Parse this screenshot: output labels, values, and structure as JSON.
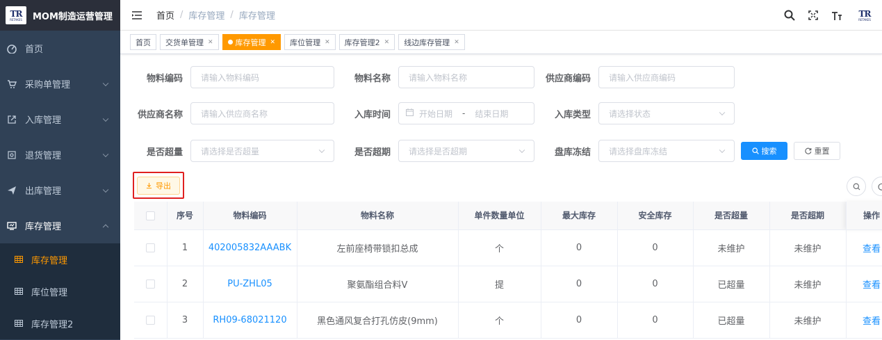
{
  "app": {
    "title": "MOM制造运营管理",
    "logo_text": "TR",
    "logo_sub": "RETAKES"
  },
  "sidebar": {
    "items": [
      {
        "label": "首页",
        "icon": "dashboard-icon"
      },
      {
        "label": "采购单管理",
        "icon": "cart-icon"
      },
      {
        "label": "入库管理",
        "icon": "external-link-icon"
      },
      {
        "label": "退货管理",
        "icon": "return-icon"
      },
      {
        "label": "出库管理",
        "icon": "send-icon"
      },
      {
        "label": "库存管理",
        "icon": "monitor-icon"
      }
    ],
    "sub_items": [
      {
        "label": "库存管理",
        "active": true
      },
      {
        "label": "库位管理"
      },
      {
        "label": "库存管理2"
      }
    ]
  },
  "breadcrumb": {
    "home": "首页",
    "level1": "库存管理",
    "level2": "库存管理",
    "sep": "/"
  },
  "tags": [
    {
      "label": "首页"
    },
    {
      "label": "交货单管理"
    },
    {
      "label": "库存管理",
      "active": true
    },
    {
      "label": "库位管理"
    },
    {
      "label": "库存管理2"
    },
    {
      "label": "线边库存管理"
    }
  ],
  "form": {
    "material_code": {
      "label": "物料编码",
      "placeholder": "请输入物料编码"
    },
    "material_name": {
      "label": "物料名称",
      "placeholder": "请输入物料名称"
    },
    "supplier_code": {
      "label": "供应商编码",
      "placeholder": "请输入供应商编码"
    },
    "supplier_name": {
      "label": "供应商名称",
      "placeholder": "请输入供应商名称"
    },
    "inbound_time": {
      "label": "入库时间",
      "start_placeholder": "开始日期",
      "range_sep": "-",
      "end_placeholder": "结束日期"
    },
    "inbound_type": {
      "label": "入库类型",
      "placeholder": "请选择状态"
    },
    "over_qty": {
      "label": "是否超量",
      "placeholder": "请选择是否超量"
    },
    "over_due": {
      "label": "是否超期",
      "placeholder": "请选择是否超期"
    },
    "inventory_freeze": {
      "label": "盘库冻结",
      "placeholder": "请选择盘库冻结"
    },
    "search_label": "搜索",
    "reset_label": "重置"
  },
  "toolbar": {
    "export_label": "导出"
  },
  "table": {
    "columns": [
      "序号",
      "物料编码",
      "物料名称",
      "单件数量单位",
      "最大库存",
      "安全库存",
      "是否超量",
      "是否超期",
      "操作"
    ],
    "rows": [
      {
        "no": "1",
        "code": "402005832AAABK",
        "name": "左前座椅带锁扣总成",
        "unit": "个",
        "max": "0",
        "safe": "0",
        "over_qty": "未维护",
        "over_due": "未维护",
        "action": "查看"
      },
      {
        "no": "2",
        "code": "PU-ZHL05",
        "name": "聚氨酯组合料V",
        "unit": "提",
        "max": "0",
        "safe": "0",
        "over_qty": "已超量",
        "over_due": "未维护",
        "action": "查看"
      },
      {
        "no": "3",
        "code": "RH09-68021120",
        "name": "黑色通风复合打孔仿皮(9mm)",
        "unit": "个",
        "max": "0",
        "safe": "0",
        "over_qty": "已超量",
        "over_due": "未维护",
        "action": "查看"
      }
    ]
  },
  "colors": {
    "sidebar_bg": "#304156",
    "accent": "#ff9900",
    "primary": "#1890ff",
    "highlight": "#e02020"
  }
}
